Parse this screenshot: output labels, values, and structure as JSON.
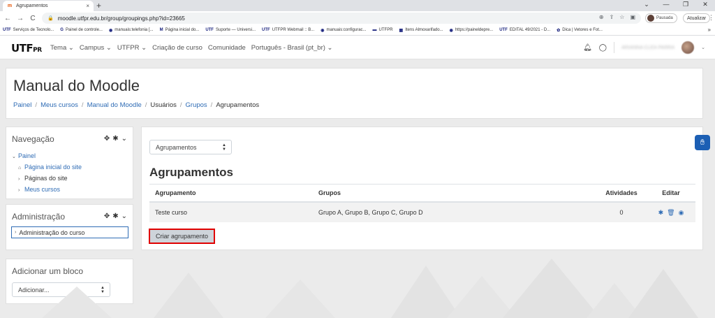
{
  "browser": {
    "tab_title": "Agrupamentos",
    "tab_close": "×",
    "new_tab": "+",
    "win_controls": [
      "⌄",
      "—",
      "❐",
      "✕"
    ],
    "nav_buttons": [
      "←",
      "→",
      "C"
    ],
    "url": "moodle.utfpr.edu.br/group/groupings.php?id=23665",
    "profile_status": "Pausada",
    "update_label": "Atualizar",
    "bookmarks": [
      {
        "icon": "UTF",
        "label": "Serviços de Tecnolo..."
      },
      {
        "icon": "G",
        "label": "Painel de controle..."
      },
      {
        "icon": "◉",
        "label": "manuais:telefonia [..."
      },
      {
        "icon": "M",
        "label": "Página inicial do..."
      },
      {
        "icon": "UTF",
        "label": "Suporte — Universi..."
      },
      {
        "icon": "UTF",
        "label": "UTFPR Webmail :: B..."
      },
      {
        "icon": "◉",
        "label": "manuais:configurac..."
      },
      {
        "icon": "▬",
        "label": "UTFPR"
      },
      {
        "icon": "▦",
        "label": "Itens Almoxarifado..."
      },
      {
        "icon": "◉",
        "label": "https://paineldepre..."
      },
      {
        "icon": "UTF",
        "label": "EDITAL 49/2021 - D..."
      },
      {
        "icon": "✿",
        "label": "Dica | Vetores e Fot..."
      }
    ]
  },
  "navbar": {
    "logo_main": "UTF",
    "logo_sub": "PR",
    "links": [
      "Tema ⌄",
      "Campus ⌄",
      "UTFPR ⌄",
      "Criação de curso",
      "Comunidade",
      "Português - Brasil (pt_br) ⌄"
    ],
    "user_name": "ARIANNA CLEA PARRA",
    "caret": "⌄"
  },
  "header": {
    "title": "Manual do Moodle",
    "breadcrumb": [
      {
        "label": "Painel",
        "link": true
      },
      {
        "label": "Meus cursos",
        "link": true
      },
      {
        "label": "Manual do Moodle",
        "link": true
      },
      {
        "label": "Usuários",
        "link": false
      },
      {
        "label": "Grupos",
        "link": true
      },
      {
        "label": "Agrupamentos",
        "link": false
      }
    ],
    "separator": "/"
  },
  "blocks": {
    "nav": {
      "title": "Navegação",
      "items": [
        {
          "caret": "⌄",
          "label": "Painel",
          "link": true
        },
        {
          "caret": "⌂",
          "label": "Página inicial do site",
          "link": true
        },
        {
          "caret": "›",
          "label": "Páginas do site",
          "link": false
        },
        {
          "caret": "›",
          "label": "Meus cursos",
          "link": true
        }
      ]
    },
    "admin": {
      "title": "Administração",
      "item": "Administração do curso"
    },
    "add": {
      "title": "Adicionar um bloco",
      "select_value": "Adicionar..."
    },
    "controls": [
      "✥",
      "✱",
      "⌄"
    ]
  },
  "main": {
    "view_select": "Agrupamentos",
    "heading": "Agrupamentos",
    "columns": [
      "Agrupamento",
      "Grupos",
      "Atividades",
      "Editar"
    ],
    "rows": [
      {
        "name": "Teste curso",
        "groups": "Grupo A, Grupo B, Grupo C, Grupo D",
        "activities": "0"
      }
    ],
    "create_button": "Criar agrupamento"
  },
  "colors": {
    "link": "#2f6cb5",
    "highlight": "#e00000",
    "a11y": "#1c5fb4"
  }
}
